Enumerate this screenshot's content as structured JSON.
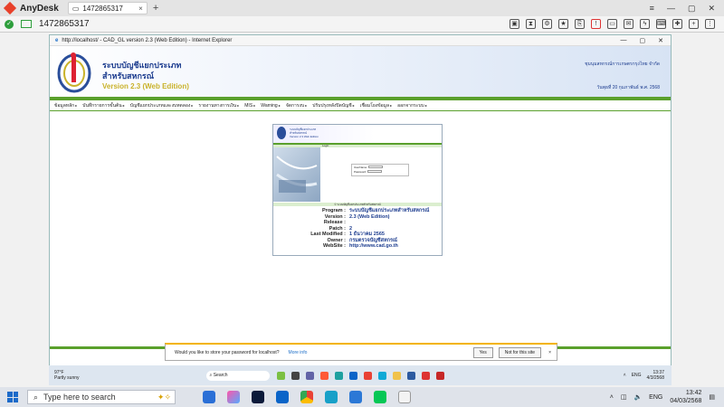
{
  "anydesk": {
    "app_name": "AnyDesk",
    "tab_label": "1472865317",
    "session_id": "1472865317"
  },
  "ie": {
    "title": "http://localhost/ - CAD_GL version 2.3 (Web Edition) - Internet Explorer"
  },
  "banner": {
    "title": "ระบบบัญชีแยกประเภท",
    "subtitle": "สำหรับสหกรณ์",
    "version": "Version 2.3 (Web Edition)",
    "org": "ชุมนุมสหกรณ์การเกษตรกรุงไทย จำกัด",
    "date": "วันพุธที่ 20 กุมภาพันธ์ พ.ศ. 2568"
  },
  "menu": [
    "ข้อมูลหลัก",
    "บันทึกรายการขั้นต้น",
    "บัญชีแยกประเภทและงบทดลอง",
    "รายงานทางการเงิน",
    "MIS",
    "Warning",
    "จัดการงบ",
    "ปรับปรุงหลังปิดบัญชี",
    "เชื่อมโยงข้อมูล",
    "ออกจากระบบ"
  ],
  "login": {
    "header_line1": "ระบบบัญชีแยกประเภท",
    "header_line2": "สำหรับสหกรณ์",
    "header_line3": "Version 2.3 Web Edition",
    "bar_label": "Login",
    "user_label": "UserName",
    "pass_label": "Password",
    "footer": "© ระบบบัญชีแยกประเภทสำหรับสหกรณ์"
  },
  "info": [
    {
      "k": "Program :",
      "v": "ระบบบัญชีแยกประเภทสำหรับสหกรณ์"
    },
    {
      "k": "Version :",
      "v": "2.3 (Web Edition)"
    },
    {
      "k": "Release :",
      "v": ""
    },
    {
      "k": "Patch :",
      "v": "2"
    },
    {
      "k": "Last Modified :",
      "v": "1 ธันวาคม 2565"
    },
    {
      "k": "Owner :",
      "v": "กรมตรวจบัญชีสหกรณ์"
    },
    {
      "k": "WebSite :",
      "v": "http://www.cad.go.th"
    }
  ],
  "notify": {
    "text": "Would you like to store your password for localhost?",
    "more": "More info",
    "yes": "Yes",
    "no": "Not for this site"
  },
  "remote_taskbar": {
    "temp": "97°F",
    "weather": "Partly sunny",
    "search": "Search",
    "lang": "ENG",
    "time": "13:37",
    "date": "4/3/2568"
  },
  "taskbar": {
    "search_placeholder": "Type here to search",
    "lang": "ENG",
    "time": "13:42",
    "date": "04/03/2568"
  },
  "colors": {
    "accent_green": "#5aa02c",
    "brand_blue": "#1d3d8f",
    "anydesk_red": "#e8402a"
  }
}
